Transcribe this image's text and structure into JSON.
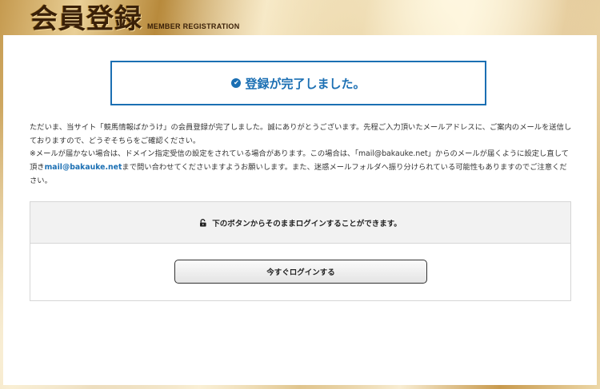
{
  "header": {
    "title": "会員登録",
    "subtitle": "MEMBER REGISTRATION"
  },
  "completion": {
    "icon": "check-circle-icon",
    "text": "登録が完了しました。"
  },
  "message": {
    "line1": "ただいま、当サイト「競馬情報ばかうけ」の会員登録が完了しました。誠にありがとうございます。先程ご入力頂いたメールアドレスに、ご案内のメールを送信しておりますので、どうぞそちらをご確認ください。",
    "line2_before": "※メールが届かない場合は、ドメイン指定受信の設定をされている場合があります。この場合は、「mail@bakauke.net」からのメールが届くように設定し直して頂き",
    "email": "mail@bakauke.net",
    "line2_after": "まで問い合わせてくださいますようお願いします。また、迷惑メールフォルダへ振り分けられている可能性もありますのでご注意ください。"
  },
  "login": {
    "icon": "unlock-icon",
    "heading": "下のボタンからそのままログインすることができます。",
    "button_label": "今すぐログインする"
  },
  "colors": {
    "accent": "#1b6fb3",
    "header_text": "#3a2008",
    "section_bg": "#f2f2f2"
  }
}
